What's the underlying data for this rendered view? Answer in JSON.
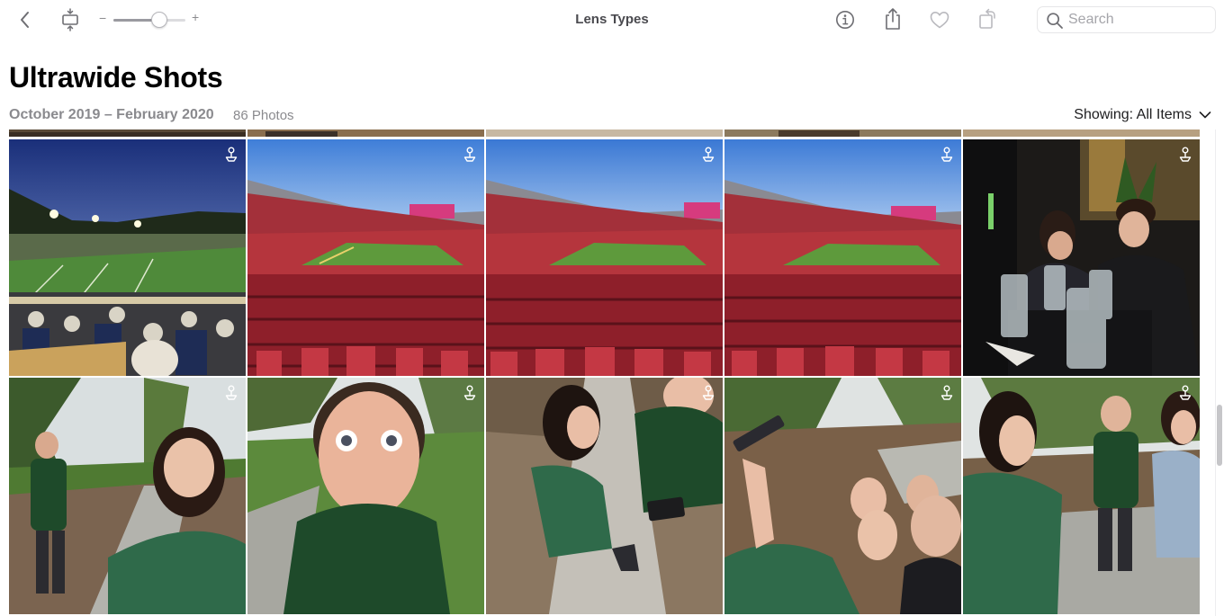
{
  "toolbar": {
    "title": "Lens Types",
    "zoom_minus": "−",
    "zoom_plus": "+",
    "zoom_level": 0.62,
    "search_placeholder": "Search"
  },
  "album": {
    "heading": "Ultrawide Shots",
    "date_range": "October 2019 – February 2020",
    "photo_count": "86 Photos",
    "showing_label": "Showing: All Items"
  }
}
